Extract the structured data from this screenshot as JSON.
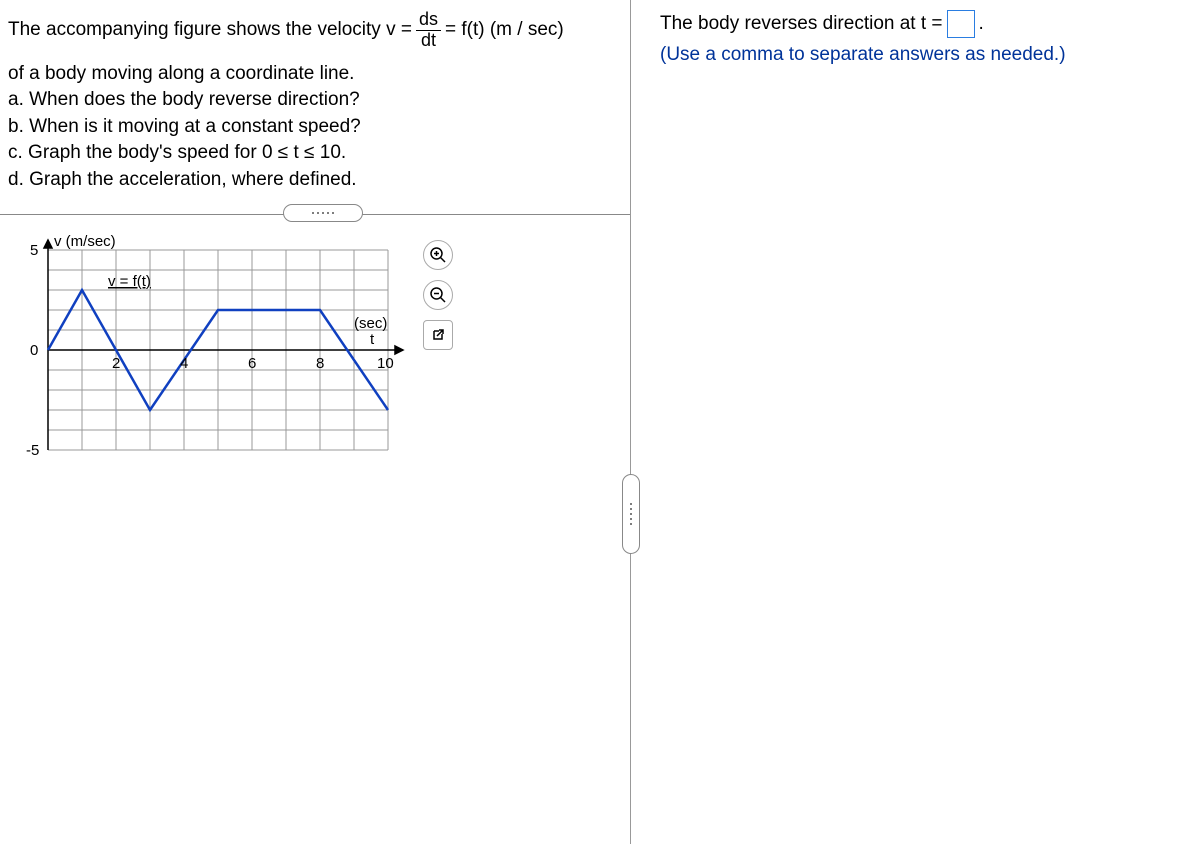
{
  "problem": {
    "line1_prefix": "The accompanying figure shows the velocity v =",
    "frac_num": "ds",
    "frac_den": "dt",
    "line1_suffix": "= f(t) (m / sec)",
    "line2": "of a body moving along a coordinate line.",
    "q_a": "a. When does the body reverse direction?",
    "q_b": "b. When is it moving at a constant speed?",
    "q_c": "c. Graph the body's speed for 0 ≤ t ≤ 10.",
    "q_d": "d. Graph the acceleration, where defined."
  },
  "chart_data": {
    "type": "line",
    "title": "",
    "xlabel": "(sec)",
    "xlabel2": "t",
    "ylabel": "v (m/sec)",
    "curve_label": "v = f(t)",
    "x_ticks": [
      0,
      2,
      4,
      6,
      8,
      10
    ],
    "y_ticks": [
      -5,
      0,
      5
    ],
    "xlim": [
      0,
      10
    ],
    "ylim": [
      -5,
      5
    ],
    "series": [
      {
        "name": "v = f(t)",
        "x": [
          0,
          1,
          3,
          5,
          8,
          10
        ],
        "y": [
          0,
          3,
          -3,
          2,
          2,
          -3
        ]
      }
    ]
  },
  "answer": {
    "prompt_prefix": "The body reverses direction at t =",
    "prompt_suffix": ".",
    "input_value": "",
    "hint": "(Use a comma to separate answers as needed.)"
  }
}
